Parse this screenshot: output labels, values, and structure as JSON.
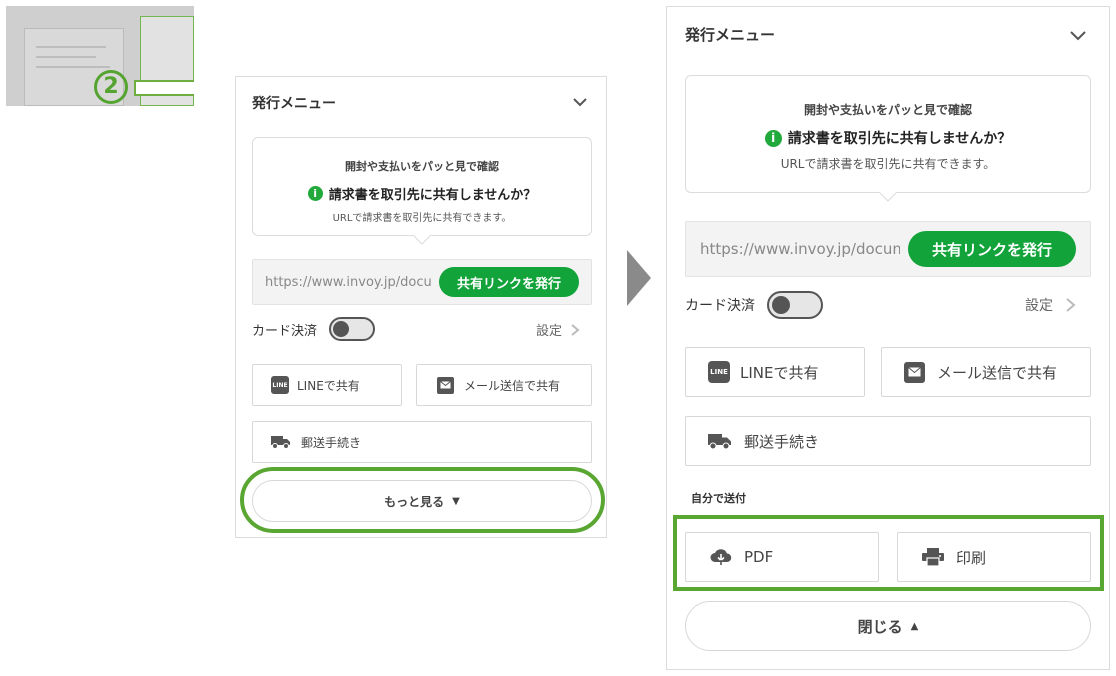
{
  "thumbnail": {
    "step_number": "2"
  },
  "panel": {
    "header": "発行メニュー",
    "bubble": {
      "top": "開封や支払いをパッと見で確認",
      "main": "請求書を取引先に共有しませんか？",
      "sub": "URLで請求書を取引先に共有できます。"
    },
    "url_text": "https://www.invoy.jp/documents",
    "share_link_button": "共有リンクを発行",
    "card_payment_label": "カード決済",
    "settings_label": "設定",
    "line_share": "LINEで共有",
    "mail_share": "メール送信で共有",
    "postal": "郵送手続き",
    "more": "もっと見る",
    "self_send_label": "自分で送付",
    "pdf": "PDF",
    "print": "印刷",
    "close": "閉じる"
  },
  "colors": {
    "accent_green": "#12a33a",
    "annotation_green": "#5aa632",
    "arrow_gray": "#8a8a8a"
  }
}
